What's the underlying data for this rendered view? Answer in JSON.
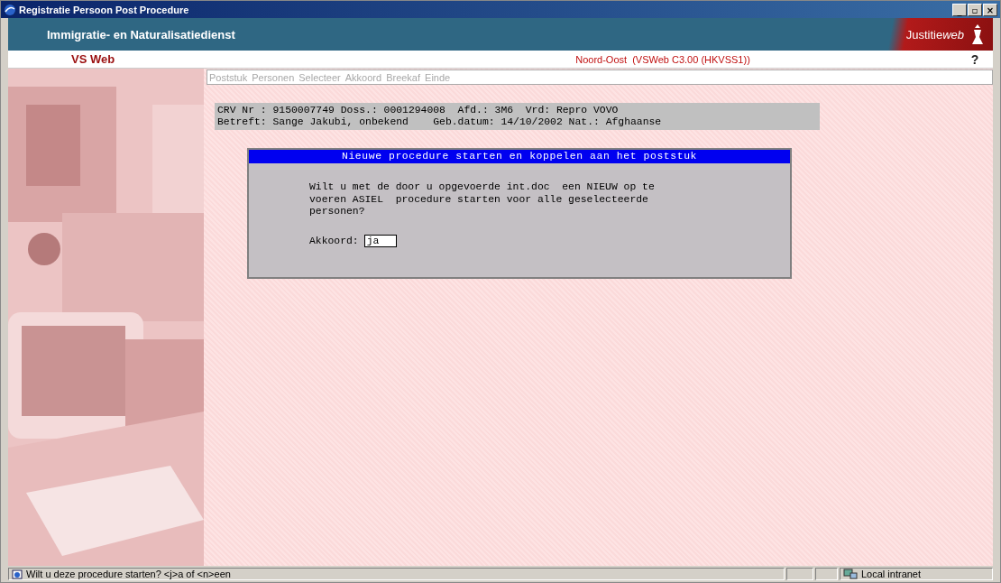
{
  "window": {
    "title": "Registratie Persoon Post Procedure",
    "controls": [
      "_",
      "▫",
      "×"
    ]
  },
  "header": {
    "organisation": "Immigratie- en Naturalisatiedienst",
    "logo_text": "Justitie",
    "logo_emphasis": "web"
  },
  "app_bar": {
    "app_name": "VS Web",
    "location": "Noord-Oost  (VSWeb C3.00 (HKVSS1))",
    "help": "?"
  },
  "menu": [
    {
      "label": "Poststuk",
      "disabled": true
    },
    {
      "label": "Personen",
      "disabled": true
    },
    {
      "label": "Selecteer",
      "disabled": true
    },
    {
      "label": "Akkoord",
      "disabled": true
    },
    {
      "label": "Breekaf",
      "disabled": true
    },
    {
      "label": "Einde",
      "disabled": true
    }
  ],
  "case_info": {
    "lines": [
      "CRV Nr : 9150007749 Doss.: 0001294008  Afd.: 3M6  Vrd: Repro VOVO",
      "Betreft: Sange Jakubi, onbekend    Geb.datum: 14/10/2002 Nat.: Afghaanse"
    ]
  },
  "dialog": {
    "title": "Nieuwe procedure starten en koppelen aan het poststuk",
    "message": [
      "Wilt u met de door u opgevoerde int.doc  een NIEUW op te",
      "voeren ASIEL  procedure starten voor alle geselecteerde",
      "personen?"
    ],
    "field_label": "Akkoord:",
    "field_value": "ja"
  },
  "status_bar": {
    "message": "Wilt u deze procedure starten? <j>a of <n>een",
    "zone": "Local intranet"
  }
}
